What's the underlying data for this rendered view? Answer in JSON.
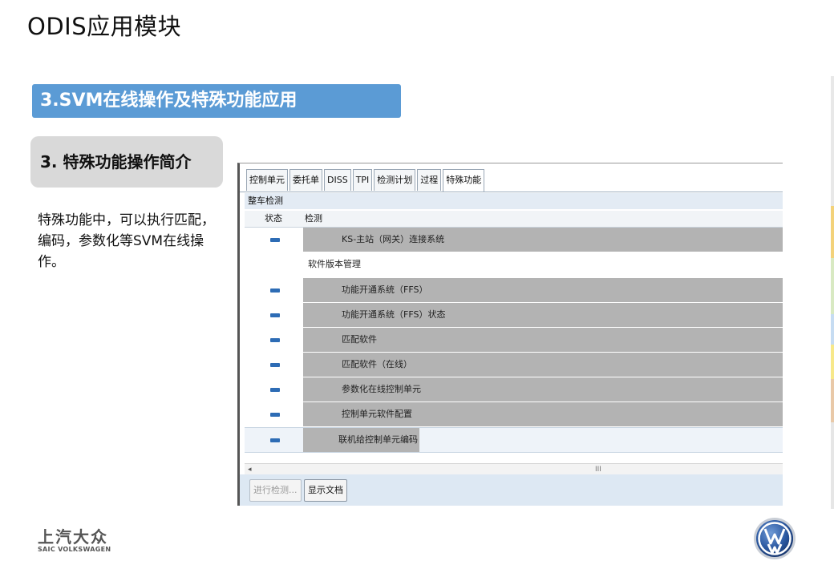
{
  "page": {
    "title": "ODIS应用模块",
    "section_banner": "3.SVM在线操作及特殊功能应用",
    "subheading": "3. 特殊功能操作简介",
    "description": "特殊功能中，可以执行匹配，编码，参数化等SVM在线操作。"
  },
  "window": {
    "tabs": [
      {
        "label": "控制单元",
        "active": false
      },
      {
        "label": "委托单",
        "active": false
      },
      {
        "label": "DISS",
        "active": false
      },
      {
        "label": "TPI",
        "active": false
      },
      {
        "label": "检测计划",
        "active": false
      },
      {
        "label": "过程",
        "active": false
      },
      {
        "label": "特殊功能",
        "active": true
      }
    ],
    "group_header": "整车检测",
    "columns": {
      "status": "状态",
      "check": "检测"
    },
    "rows": [
      {
        "label": "KS-主站（网关）连接系统",
        "type": "item",
        "indicator": "blue"
      },
      {
        "label": "软件版本管理",
        "type": "section"
      },
      {
        "label": "功能开通系统（FFS）",
        "type": "item",
        "indicator": "blue"
      },
      {
        "label": "功能开通系统（FFS）状态",
        "type": "item",
        "indicator": "blue"
      },
      {
        "label": "匹配软件",
        "type": "item",
        "indicator": "blue"
      },
      {
        "label": "匹配软件（在线）",
        "type": "item",
        "indicator": "blue"
      },
      {
        "label": "参数化在线控制单元",
        "type": "item",
        "indicator": "blue"
      },
      {
        "label": "控制单元软件配置",
        "type": "item",
        "indicator": "blue"
      },
      {
        "label": "联机给控制单元编码",
        "type": "item",
        "indicator": "blue",
        "selected": true
      }
    ],
    "scroll_left": "◂",
    "scroll_grip": "III",
    "buttons": {
      "run_check": "进行检测...",
      "show_doc": "显示文档"
    }
  },
  "footer": {
    "brand_cn": "上汽大众",
    "brand_en": "SAIC VOLKSWAGEN",
    "vw_logo": "VW"
  },
  "colors": {
    "banner": "#5b9bd5",
    "subheading_bg": "#d9d9d9",
    "indicator": "#2d6cb5",
    "row_shade": "#b3b3b3"
  }
}
